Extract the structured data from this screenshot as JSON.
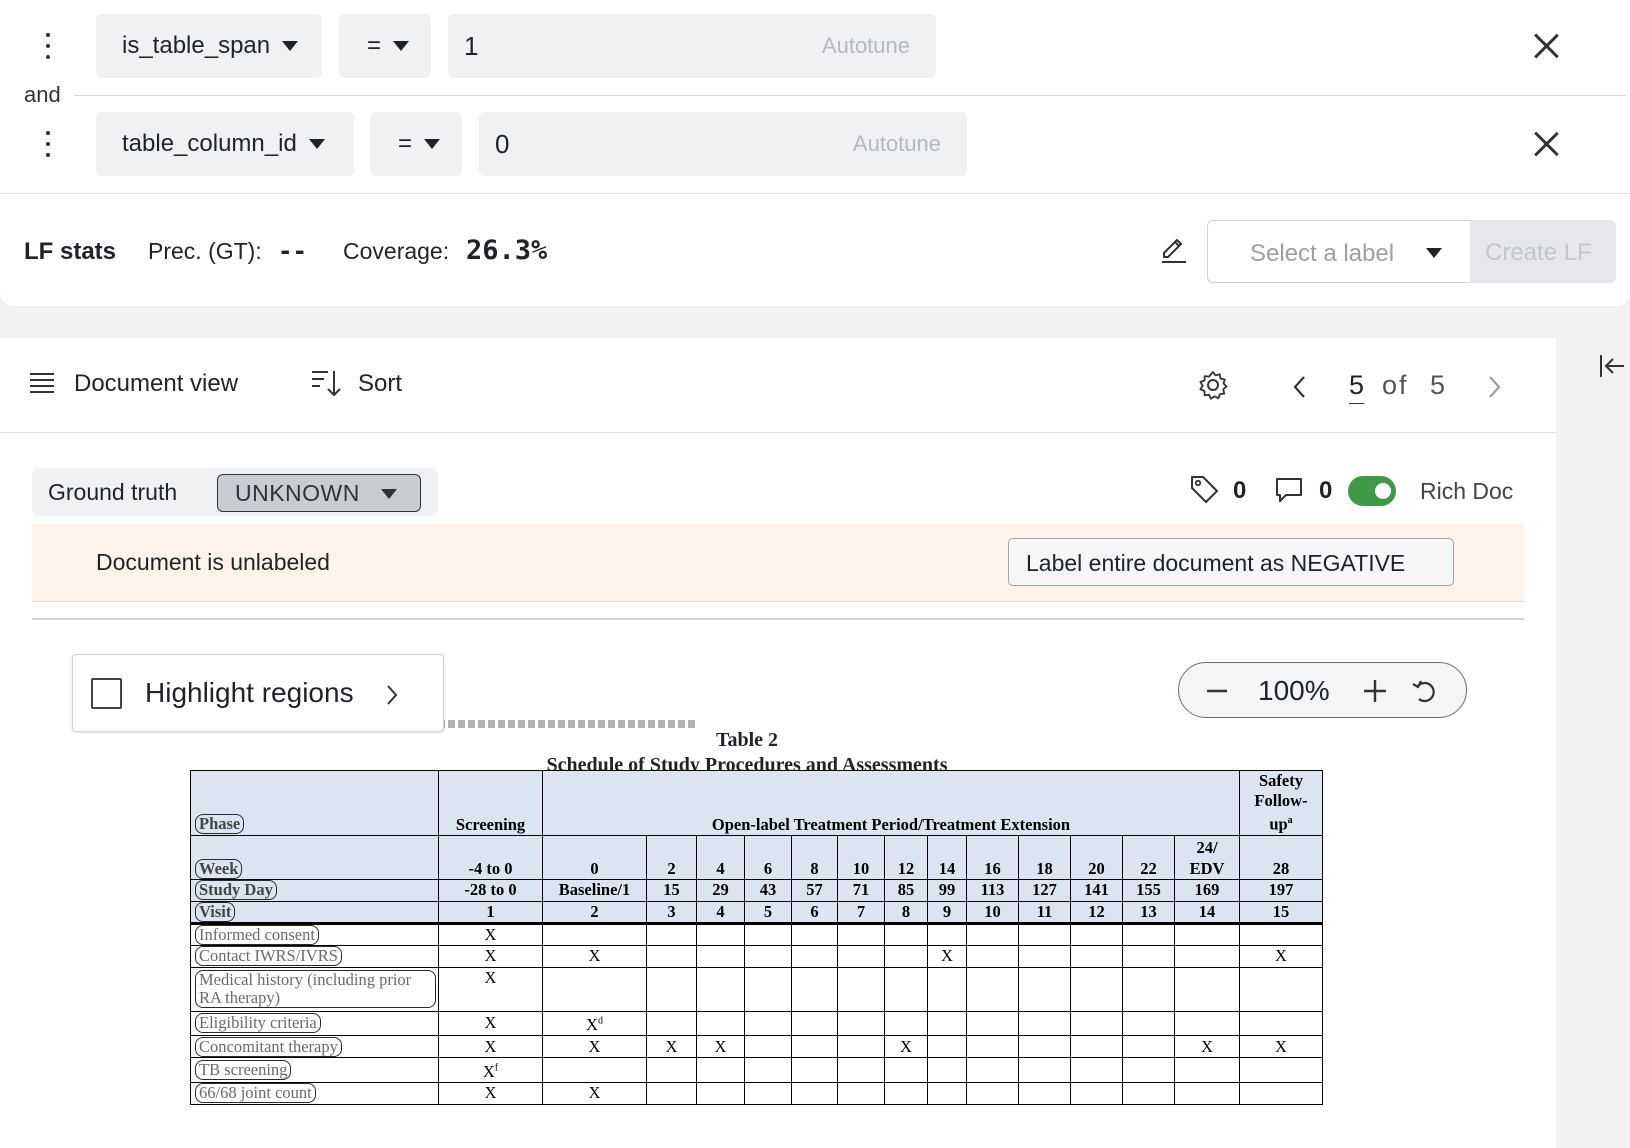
{
  "filters": [
    {
      "field": "is_table_span",
      "op": "=",
      "value": "1",
      "autotune": "Autotune"
    },
    {
      "field": "table_column_id",
      "op": "=",
      "value": "0",
      "autotune": "Autotune"
    }
  ],
  "connector": "and",
  "stats": {
    "title": "LF stats",
    "prec_label": "Prec. (GT):",
    "prec_value": "--",
    "coverage_label": "Coverage:",
    "coverage_value": "26.3%",
    "select_label": "Select a label",
    "create_button": "Create LF"
  },
  "toolbar": {
    "document_view": "Document view",
    "sort": "Sort",
    "page_current": "5",
    "page_of": "of",
    "page_total": "5"
  },
  "doc": {
    "ground_truth_label": "Ground truth",
    "ground_truth_value": "UNKNOWN",
    "tag_count": "0",
    "comment_count": "0",
    "rich_doc_label": "Rich Doc",
    "unlabeled_text": "Document is unlabeled",
    "label_negative_button": "Label entire document as NEGATIVE",
    "highlight_label": "Highlight regions",
    "zoom": "100%",
    "table_title": "Table 2",
    "table_subtitle": "Schedule of Study Procedures and Assessments"
  },
  "schedule": {
    "phase_label": "Phase",
    "screening": "Screening",
    "open_label": "Open-label Treatment Period/Treatment Extension",
    "safety": [
      "Safety",
      "Follow-",
      "up"
    ],
    "safety_sup": "a",
    "week_label": "Week",
    "weeks": [
      "-4 to 0",
      "0",
      "2",
      "4",
      "6",
      "8",
      "10",
      "12",
      "14",
      "16",
      "18",
      "20",
      "22",
      "24/ EDV",
      "28"
    ],
    "day_label": "Study Day",
    "days": [
      "-28 to 0",
      "Baseline/1",
      "15",
      "29",
      "43",
      "57",
      "71",
      "85",
      "99",
      "113",
      "127",
      "141",
      "155",
      "169",
      "197"
    ],
    "visit_label": "Visit",
    "visits": [
      "1",
      "2",
      "3",
      "4",
      "5",
      "6",
      "7",
      "8",
      "9",
      "10",
      "11",
      "12",
      "13",
      "14",
      "15"
    ],
    "rows": [
      {
        "label": "Informed consent",
        "cells": [
          "X",
          "",
          "",
          "",
          "",
          "",
          "",
          "",
          "",
          "",
          "",
          "",
          "",
          "",
          ""
        ]
      },
      {
        "label": "Contact IWRS/IVRS",
        "cells": [
          "X",
          "X",
          "",
          "",
          "",
          "",
          "",
          "",
          "X",
          "",
          "",
          "",
          "",
          "",
          "X"
        ]
      },
      {
        "label": "Medical history (including prior RA therapy)",
        "cells": [
          "X",
          "",
          "",
          "",
          "",
          "",
          "",
          "",
          "",
          "",
          "",
          "",
          "",
          "",
          ""
        ]
      },
      {
        "label": "Eligibility criteria",
        "cells": [
          "X",
          "Xd",
          "",
          "",
          "",
          "",
          "",
          "",
          "",
          "",
          "",
          "",
          "",
          "",
          ""
        ]
      },
      {
        "label": "Concomitant therapy",
        "cells": [
          "X",
          "X",
          "X",
          "X",
          "",
          "",
          "",
          "X",
          "",
          "",
          "",
          "",
          "",
          "X",
          "X"
        ]
      },
      {
        "label": "TB screening",
        "cells": [
          "Xf",
          "",
          "",
          "",
          "",
          "",
          "",
          "",
          "",
          "",
          "",
          "",
          "",
          "",
          ""
        ]
      },
      {
        "label": "66/68 joint count",
        "cells": [
          "X",
          "X",
          "",
          "",
          "",
          "",
          "",
          "",
          "",
          "",
          "",
          "",
          "",
          "",
          ""
        ]
      }
    ]
  }
}
